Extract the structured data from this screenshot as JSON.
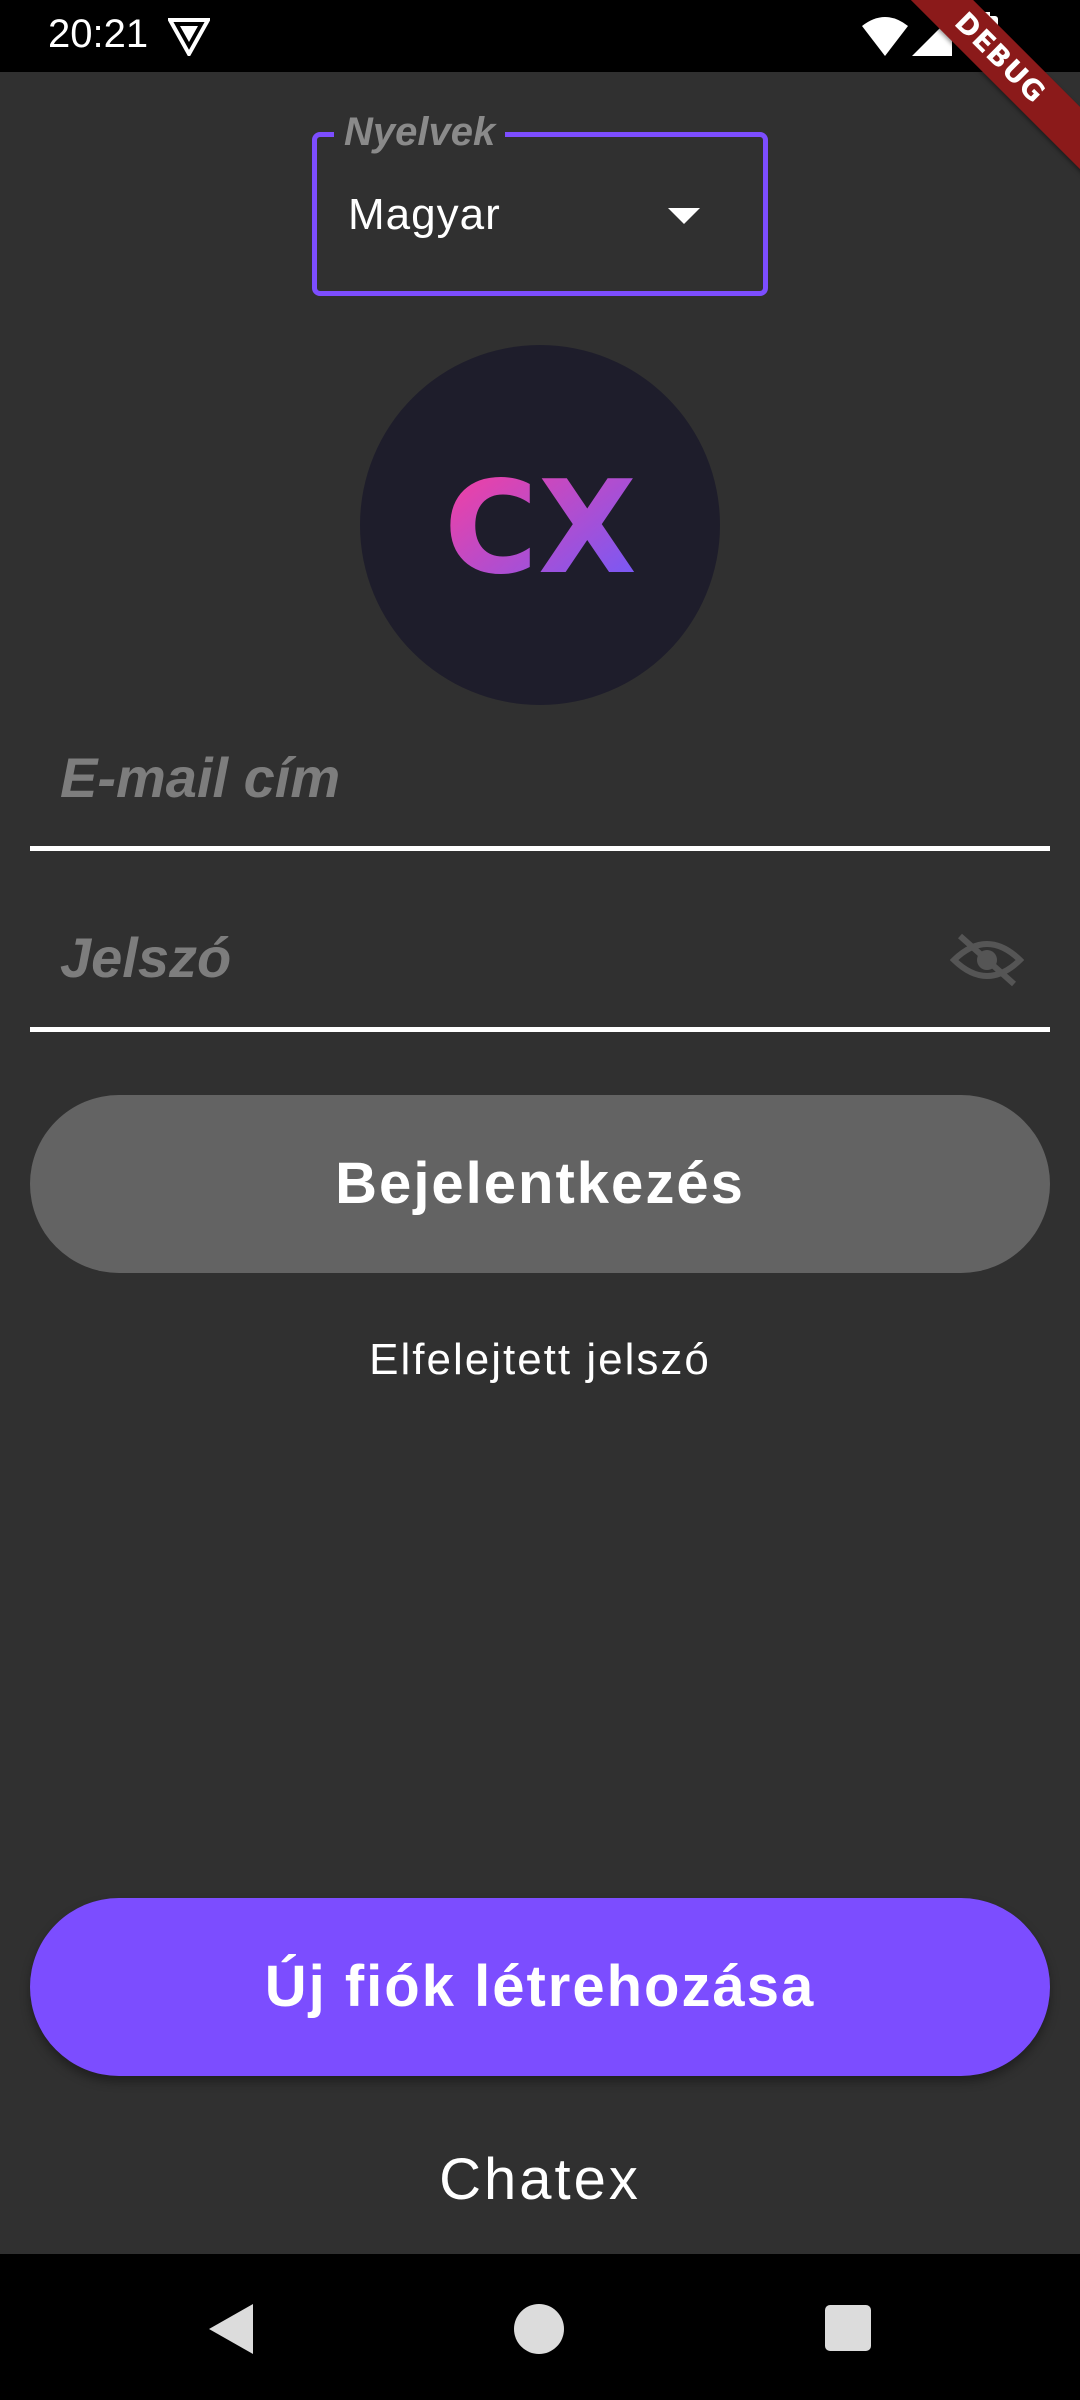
{
  "status_bar": {
    "time": "20:21",
    "icons": [
      "vpn-icon",
      "wifi-icon",
      "signal-icon",
      "battery-icon"
    ]
  },
  "debug_banner": "DEBUG",
  "language": {
    "label": "Nyelvek",
    "value": "Magyar"
  },
  "logo": {
    "text": "CX",
    "colors": [
      "#ff3d9a",
      "#7c4dff"
    ]
  },
  "email": {
    "placeholder": "E-mail cím"
  },
  "password": {
    "placeholder": "Jelszó",
    "visibility_icon": "visibility-off-icon"
  },
  "login_button": "Bejelentkezés",
  "forgot_password": "Elfelejtett jelszó",
  "register_button": "Új fiók létrehozása",
  "app_name": "Chatex",
  "nav": {
    "icons": [
      "back-icon",
      "home-icon",
      "recents-icon"
    ]
  },
  "colors": {
    "accent": "#7c4dff",
    "background": "#303030",
    "disabled_button": "#636363"
  }
}
